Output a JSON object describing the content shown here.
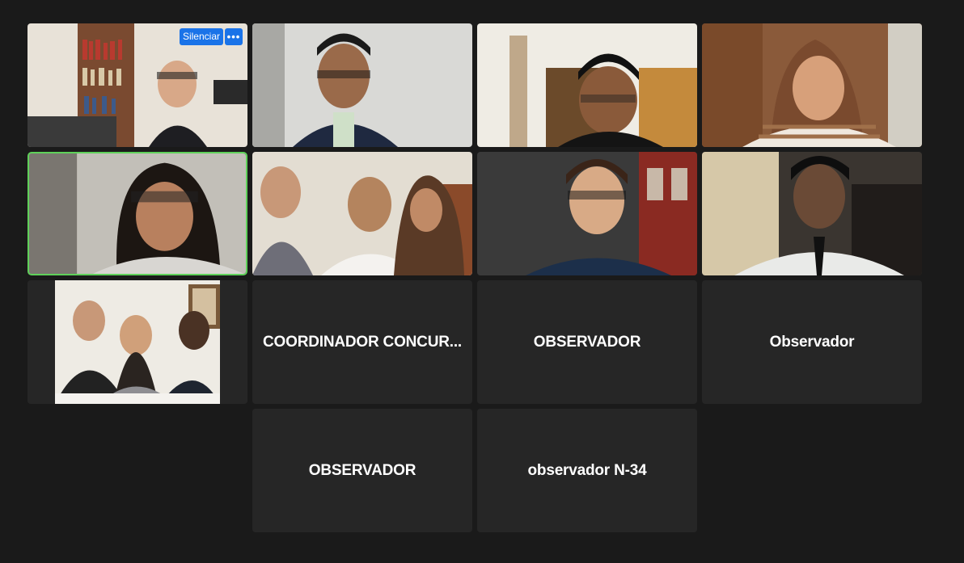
{
  "participants": [
    {
      "type": "video",
      "name": "",
      "active": false,
      "controls": {
        "mute_label": "Silenciar",
        "more_icon": "more-icon"
      }
    },
    {
      "type": "video",
      "name": "",
      "active": false
    },
    {
      "type": "video",
      "name": "",
      "active": false
    },
    {
      "type": "video",
      "name": "",
      "active": false
    },
    {
      "type": "video",
      "name": "",
      "active": true
    },
    {
      "type": "video",
      "name": "",
      "active": false
    },
    {
      "type": "video",
      "name": "",
      "active": false
    },
    {
      "type": "video",
      "name": "",
      "active": false
    },
    {
      "type": "video",
      "name": "",
      "active": false
    },
    {
      "type": "name",
      "name": "COORDINADOR CONCUR...",
      "active": false
    },
    {
      "type": "name",
      "name": "OBSERVADOR",
      "active": false
    },
    {
      "type": "name",
      "name": "Observador",
      "active": false
    },
    {
      "type": "name",
      "name": "OBSERVADOR",
      "active": false
    },
    {
      "type": "name",
      "name": "observador N-34",
      "active": false
    }
  ],
  "colors": {
    "background": "#1a1a1a",
    "tile": "#262626",
    "active_border": "#5fd15a",
    "button_blue": "#1a73e8"
  }
}
